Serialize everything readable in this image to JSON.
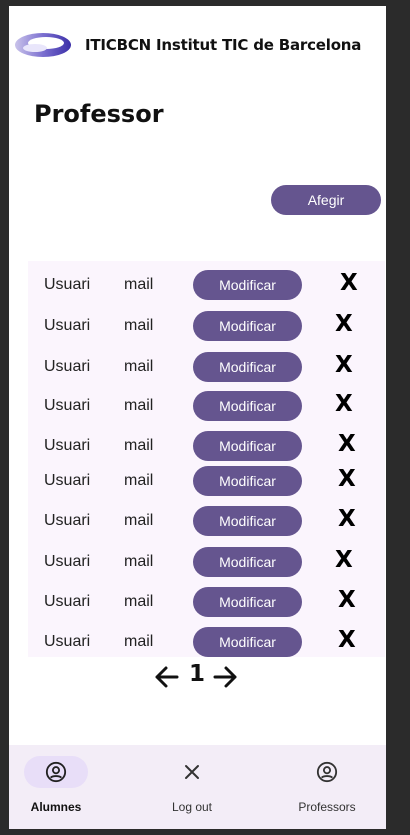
{
  "header": {
    "brand": "ITICBCN Institut TIC de Barcelona",
    "logo": "iticbcn-logo"
  },
  "page": {
    "title": "Professor"
  },
  "actions": {
    "add_label": "Afegir"
  },
  "rows": [
    {
      "user": "Usuari",
      "mail": "mail",
      "modify": "Modificar",
      "delete": "X"
    },
    {
      "user": "Usuari",
      "mail": "mail",
      "modify": "Modificar",
      "delete": "X"
    },
    {
      "user": "Usuari",
      "mail": "mail",
      "modify": "Modificar",
      "delete": "X"
    },
    {
      "user": "Usuari",
      "mail": "mail",
      "modify": "Modificar",
      "delete": "X"
    },
    {
      "user": "Usuari",
      "mail": "mail",
      "modify": "Modificar",
      "delete": "X"
    },
    {
      "user": "Usuari",
      "mail": "mail",
      "modify": "Modificar",
      "delete": "X"
    },
    {
      "user": "Usuari",
      "mail": "mail",
      "modify": "Modificar",
      "delete": "X"
    },
    {
      "user": "Usuari",
      "mail": "mail",
      "modify": "Modificar",
      "delete": "X"
    },
    {
      "user": "Usuari",
      "mail": "mail",
      "modify": "Modificar",
      "delete": "X"
    },
    {
      "user": "Usuari",
      "mail": "mail",
      "modify": "Modificar",
      "delete": "X"
    }
  ],
  "pagination": {
    "current_page": "1",
    "prev_icon": "arrow-left-icon",
    "next_icon": "arrow-right-icon"
  },
  "nav": {
    "items": [
      {
        "label": "Alumnes",
        "icon": "account-circle-icon",
        "active": true
      },
      {
        "label": "Log out",
        "icon": "close-icon",
        "active": false
      },
      {
        "label": "Professors",
        "icon": "account-circle-icon",
        "active": false
      }
    ]
  },
  "colors": {
    "primary": "#65558f",
    "table_bg": "#fbf5fd",
    "nav_bg": "#f3edf7",
    "nav_active": "#e8def8"
  }
}
